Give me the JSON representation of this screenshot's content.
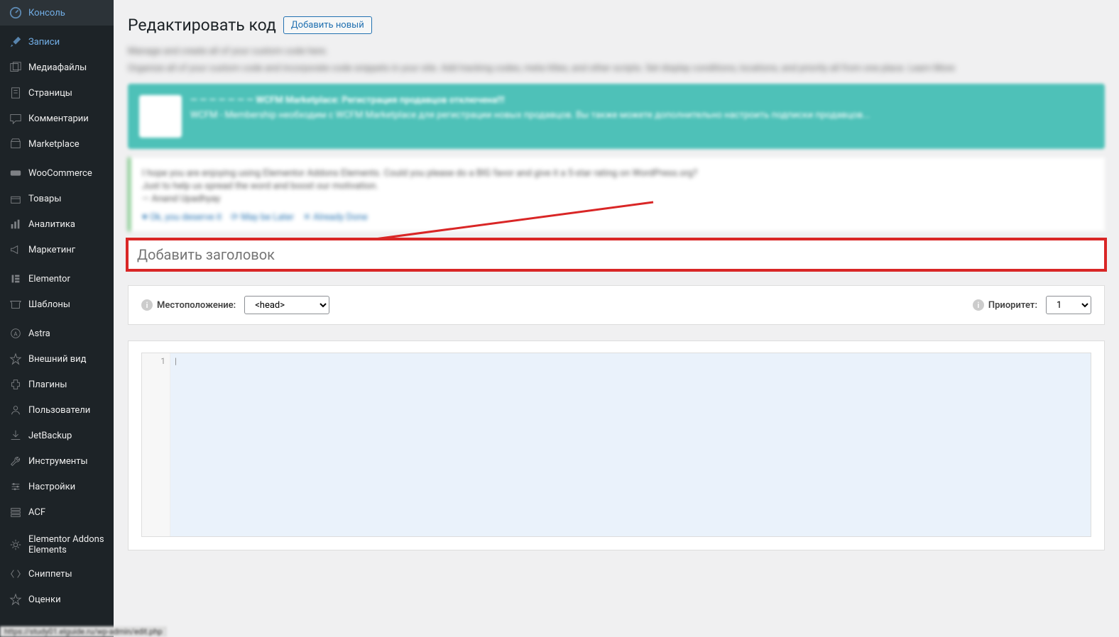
{
  "sidebar": {
    "items": [
      {
        "label": "Консоль",
        "icon": "dashboard"
      },
      {
        "label": "Записи",
        "icon": "pin"
      },
      {
        "label": "Медиафайлы",
        "icon": "media"
      },
      {
        "label": "Страницы",
        "icon": "pages"
      },
      {
        "label": "Комментарии",
        "icon": "comment"
      },
      {
        "label": "Marketplace",
        "icon": "marketplace"
      },
      {
        "label": "WooCommerce",
        "icon": "woo"
      },
      {
        "label": "Товары",
        "icon": "products"
      },
      {
        "label": "Аналитика",
        "icon": "analytics"
      },
      {
        "label": "Маркетинг",
        "icon": "marketing"
      },
      {
        "label": "Elementor",
        "icon": "elementor"
      },
      {
        "label": "Шаблоны",
        "icon": "templates"
      },
      {
        "label": "Astra",
        "icon": "astra"
      },
      {
        "label": "Внешний вид",
        "icon": "appearance"
      },
      {
        "label": "Плагины",
        "icon": "plugins"
      },
      {
        "label": "Пользователи",
        "icon": "users"
      },
      {
        "label": "JetBackup",
        "icon": "backup"
      },
      {
        "label": "Инструменты",
        "icon": "tools"
      },
      {
        "label": "Настройки",
        "icon": "settings"
      },
      {
        "label": "ACF",
        "icon": "acf"
      },
      {
        "label": "Elementor Addons Elements",
        "icon": "addons"
      },
      {
        "label": "Сниппеты",
        "icon": "snippets"
      },
      {
        "label": "Оценки",
        "icon": "ratings"
      }
    ]
  },
  "header": {
    "title": "Редактировать код",
    "add_new": "Добавить новый"
  },
  "intro": {
    "line1": "Manage and create all of your custom code here.",
    "line2": "Organize all of your custom code and incorporate code snippets in your site. Add tracking codes, meta titles, and other scripts. Set display conditions, locations, and priority all from one place. Learn More"
  },
  "title_field": {
    "placeholder": "Добавить заголовок"
  },
  "meta": {
    "location_label": "Местоположение:",
    "location_value": "<head>",
    "priority_label": "Приоритет:",
    "priority_value": "1"
  },
  "editor": {
    "gutter_line": "1"
  },
  "status_bar": "https://study01.elguide.ru/wp-admin/edit.php"
}
